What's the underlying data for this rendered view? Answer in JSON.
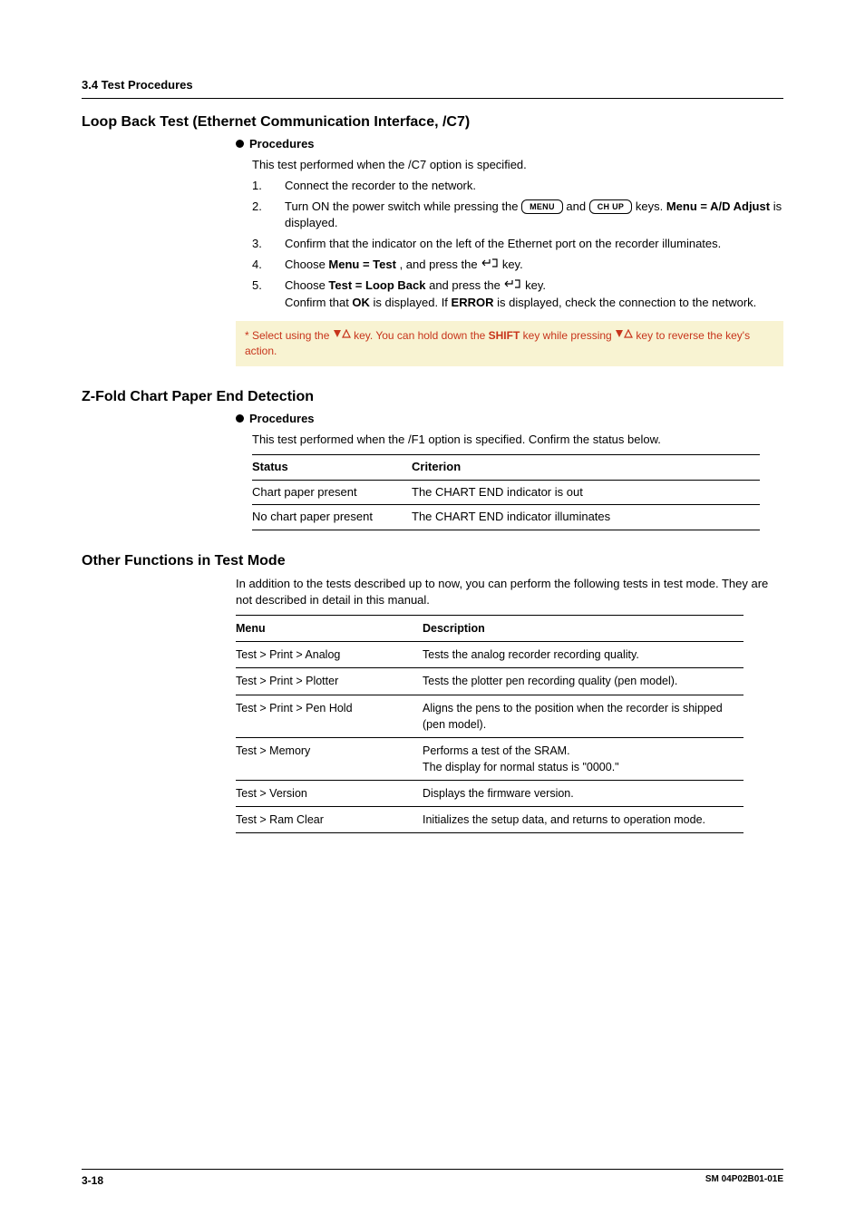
{
  "header": {
    "section_tag": "3.4  Test Procedures"
  },
  "loopback": {
    "title": "Loop Back Test (Ethernet Communication Interface, /C7)",
    "procedures_label": "Procedures",
    "intro": "This test performed when the /C7 option is specified.",
    "steps": {
      "s1": {
        "n": "1.",
        "t": "Connect the recorder to the network."
      },
      "s2": {
        "n": "2.",
        "pre": "Turn ON the power switch while pressing the ",
        "key1": "MENU",
        "mid": " and ",
        "key2": "CH UP",
        "post": " keys. ",
        "bold1": "Menu = A/D Adjust",
        "tail": " is displayed."
      },
      "s3": {
        "n": "3.",
        "t": "Confirm that the indicator on the left of the Ethernet port on the recorder illuminates."
      },
      "s4": {
        "n": "4.",
        "pre": "Choose ",
        "bold": "Menu = Test",
        "mid": ", and press the ",
        "tail": " key."
      },
      "s5": {
        "n": "5.",
        "pre": "Choose ",
        "bold": "Test = Loop Back",
        "mid": " and press the ",
        "tail": " key.",
        "line2a": "Confirm that ",
        "line2b": "OK",
        "line2c": " is displayed. If ",
        "line2d": "ERROR",
        "line2e": " is displayed, check the connection to the network."
      }
    },
    "note": {
      "pre": "*  Select using the ",
      "mid": " key. You can hold down the ",
      "shift": "SHIFT",
      "mid2": " key while pressing ",
      "post": " key to reverse the key's action."
    }
  },
  "zfold": {
    "title": "Z-Fold Chart Paper End Detection",
    "procedures_label": "Procedures",
    "intro": "This test performed when the /F1 option is specified. Confirm the status below.",
    "table": {
      "h1": "Status",
      "h2": "Criterion",
      "r1c1": "Chart paper present",
      "r1c2": "The CHART END indicator is out",
      "r2c1": "No chart paper present",
      "r2c2": "The CHART END indicator illuminates"
    }
  },
  "other": {
    "title": "Other Functions in Test Mode",
    "intro": "In addition to the tests described up to now, you can perform the following tests in test mode. They are not described in detail in this manual.",
    "table": {
      "h1": "Menu",
      "h2": "Description",
      "r1c1": "Test > Print > Analog",
      "r1c2": "Tests the analog recorder recording quality.",
      "r2c1": "Test > Print > Plotter",
      "r2c2": "Tests the plotter pen recording quality (pen model).",
      "r3c1": "Test > Print > Pen Hold",
      "r3c2": "Aligns the pens to the position when the recorder is shipped (pen model).",
      "r4c1": "Test > Memory",
      "r4c2a": "Performs a test of the SRAM.",
      "r4c2b": "The display for normal status is \"0000.\"",
      "r5c1": "Test > Version",
      "r5c2": "Displays the firmware version.",
      "r6c1": "Test > Ram Clear",
      "r6c2": "Initializes the setup data, and returns to operation mode."
    }
  },
  "footer": {
    "page": "3-18",
    "docno": "SM 04P02B01-01E"
  }
}
